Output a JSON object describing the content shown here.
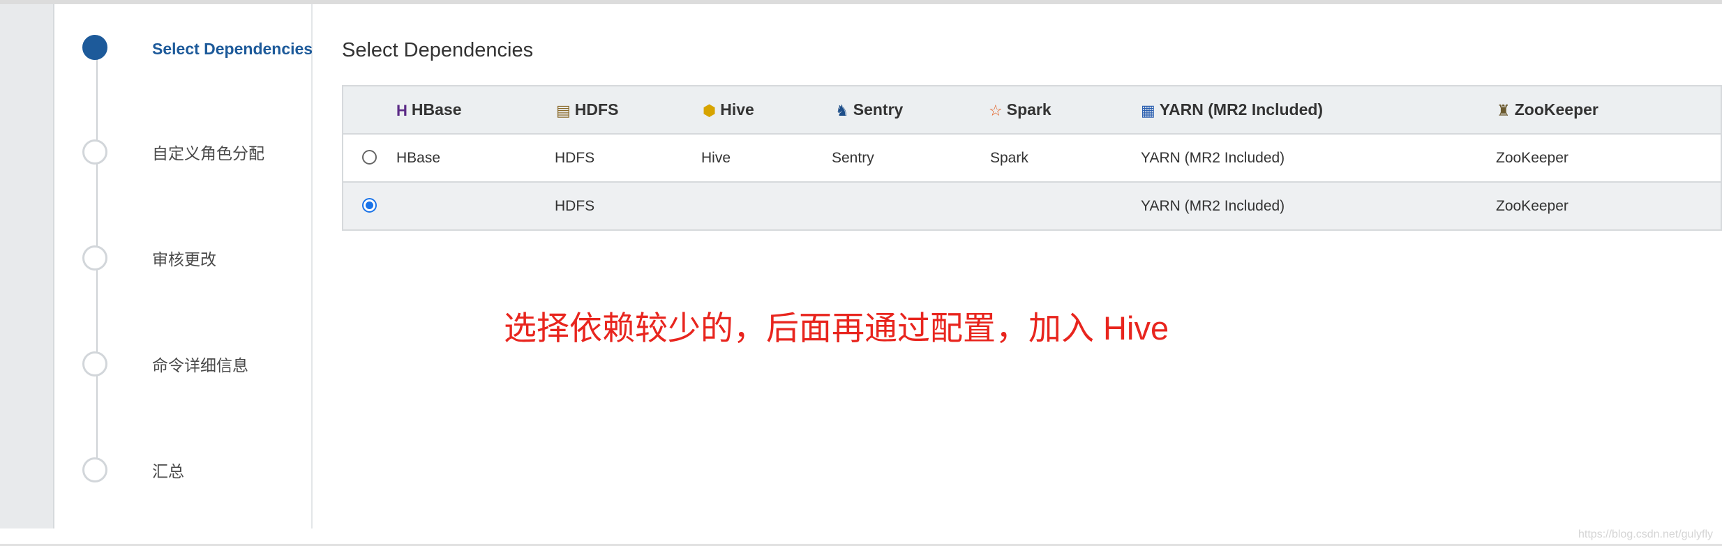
{
  "steps": [
    {
      "label": "Select Dependencies",
      "active": true
    },
    {
      "label": "自定义角色分配",
      "active": false
    },
    {
      "label": "审核更改",
      "active": false
    },
    {
      "label": "命令详细信息",
      "active": false
    },
    {
      "label": "汇总",
      "active": false
    }
  ],
  "main": {
    "title": "Select Dependencies"
  },
  "table": {
    "headers": [
      {
        "label": "HBase",
        "icon": "hbase-icon"
      },
      {
        "label": "HDFS",
        "icon": "hdfs-icon"
      },
      {
        "label": "Hive",
        "icon": "hive-icon"
      },
      {
        "label": "Sentry",
        "icon": "sentry-icon"
      },
      {
        "label": "Spark",
        "icon": "spark-icon"
      },
      {
        "label": "YARN (MR2 Included)",
        "icon": "yarn-icon"
      },
      {
        "label": "ZooKeeper",
        "icon": "zookeeper-icon"
      }
    ],
    "rows": [
      {
        "selected": false,
        "cells": [
          "HBase",
          "HDFS",
          "Hive",
          "Sentry",
          "Spark",
          "YARN (MR2 Included)",
          "ZooKeeper"
        ]
      },
      {
        "selected": true,
        "cells": [
          "",
          "HDFS",
          "",
          "",
          "",
          "YARN (MR2 Included)",
          "ZooKeeper"
        ]
      }
    ]
  },
  "annotation": "选择依赖较少的，后面再通过配置，加入 Hive",
  "watermark": "https://blog.csdn.net/gulyfly",
  "colors": {
    "accent": "#1d5a9a",
    "radio": "#1a73e8",
    "annotation": "#e8251e"
  }
}
